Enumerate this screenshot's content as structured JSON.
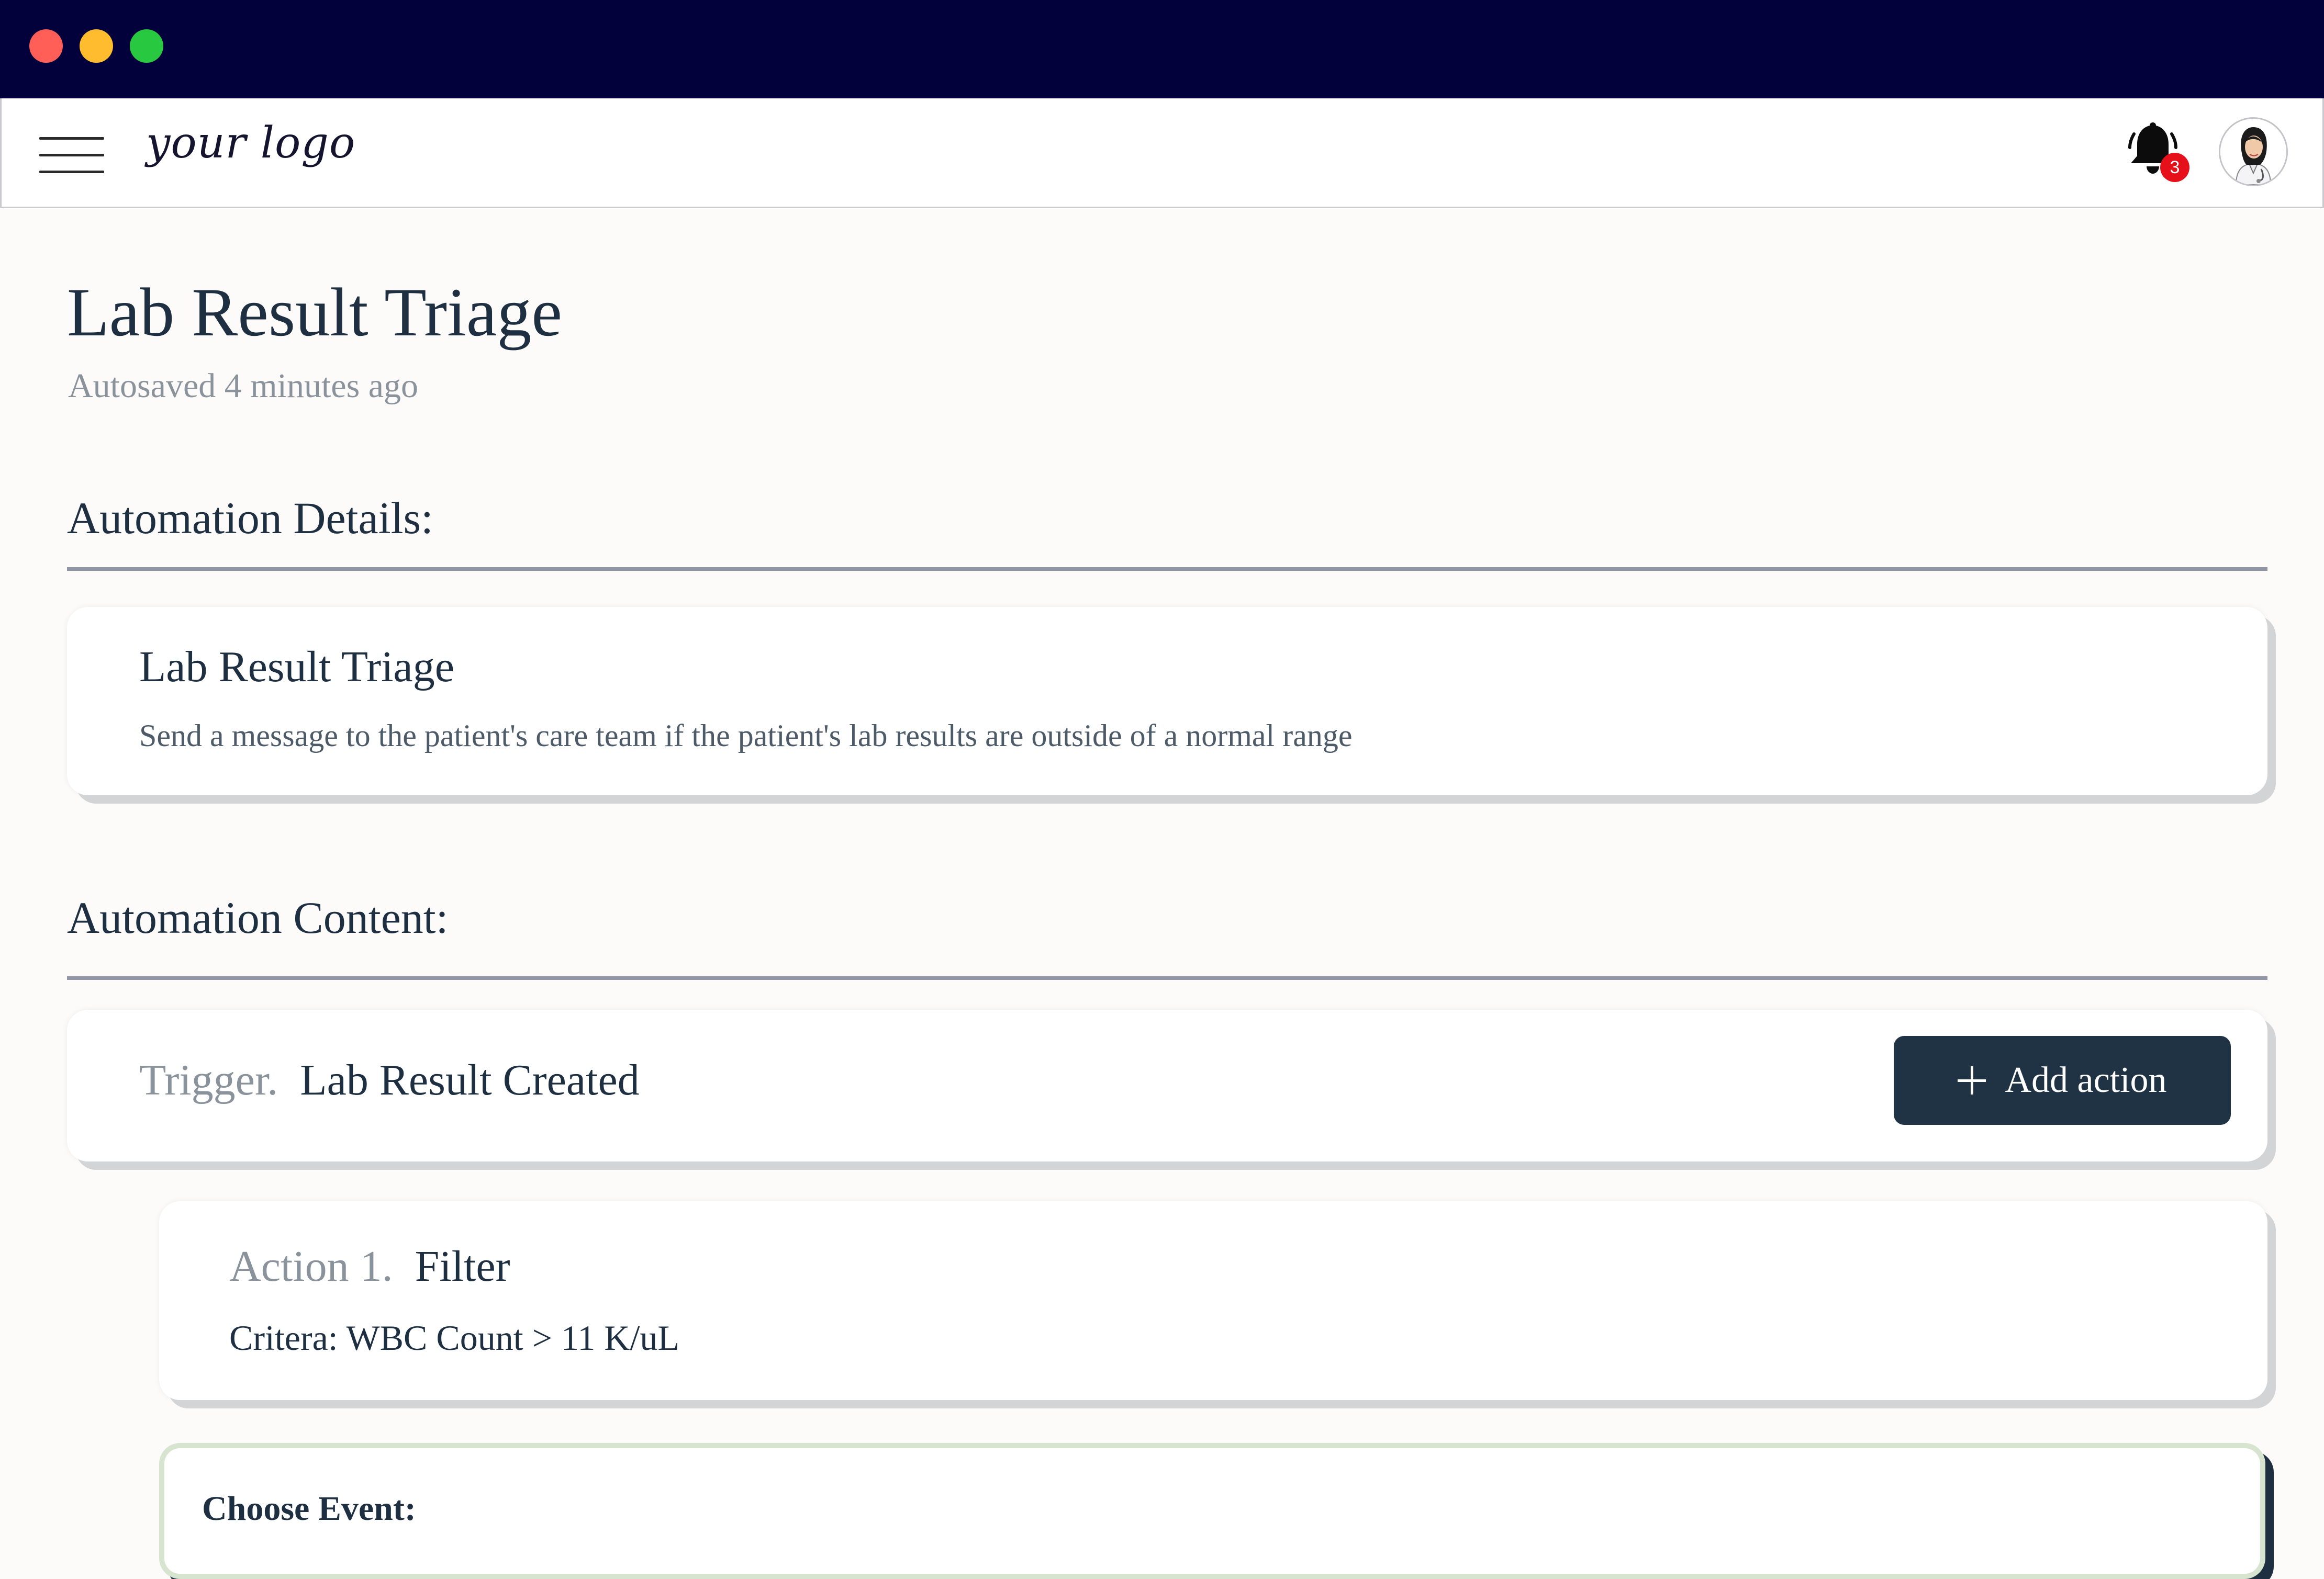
{
  "window": {
    "controls": [
      "close",
      "minimize",
      "maximize"
    ]
  },
  "navbar": {
    "logo_text": "your logo",
    "notifications_count": "3",
    "menu_icon": "hamburger-menu-icon",
    "bell_icon": "bell-icon"
  },
  "page": {
    "title": "Lab Result Triage",
    "autosave": "Autosaved 4 minutes ago"
  },
  "details": {
    "heading": "Automation Details:",
    "name": "Lab Result Triage",
    "description": "Send a message to the patient's care team if the patient's lab results are outside of a normal range"
  },
  "content": {
    "heading": "Automation Content:",
    "trigger": {
      "prefix": "Trigger.",
      "name": "Lab Result Created",
      "add_action_label": "Add action"
    },
    "actions": [
      {
        "prefix": "Action 1.",
        "name": "Filter",
        "criteria": "Critera: WBC Count > 11 K/uL"
      }
    ],
    "event": {
      "label": "Choose Event:"
    }
  },
  "colors": {
    "titlebar": "#02013b",
    "text_primary": "#1e2f42",
    "text_muted": "#8a939b",
    "button": "#1f3344",
    "badge": "#e6101a",
    "event_border": "#d7e4cf"
  }
}
